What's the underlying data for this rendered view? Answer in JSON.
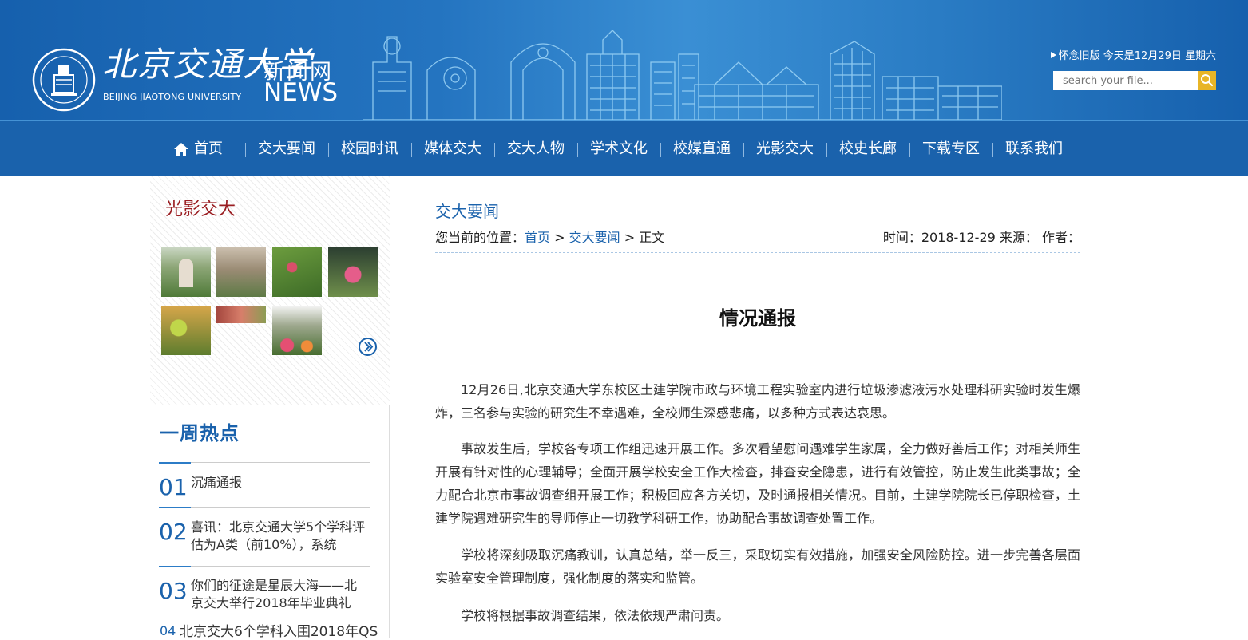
{
  "header": {
    "logo_cn": "北京交通大学",
    "logo_en": "BEIJING JIAOTONG UNIVERSITY",
    "news_cn": "新闻网",
    "news_en": "NEWS",
    "old_version": "怀念旧版",
    "date_text": "今天是12月29日  星期六",
    "search_placeholder": "search your file..."
  },
  "nav": [
    {
      "label": "首页",
      "icon": "home-icon"
    },
    {
      "label": "交大要闻"
    },
    {
      "label": "校园时讯"
    },
    {
      "label": "媒体交大"
    },
    {
      "label": "交大人物"
    },
    {
      "label": "学术文化"
    },
    {
      "label": "校媒直通"
    },
    {
      "label": "光影交大"
    },
    {
      "label": "校史长廊"
    },
    {
      "label": "下载专区"
    },
    {
      "label": "联系我们"
    }
  ],
  "sidebar": {
    "gallery_title": "光影交大",
    "hot_title": "一周热点",
    "hot": [
      {
        "num": "01",
        "text": "沉痛通报"
      },
      {
        "num": "02",
        "text": "喜讯：北京交通大学5个学科评估为A类（前10%），系统"
      },
      {
        "num": "03",
        "text": "你们的征途是星辰大海——北京交大举行2018年毕业典礼"
      },
      {
        "num": "04",
        "text": "北京交大6个学科入围2018年QS"
      }
    ]
  },
  "main": {
    "section_title": "交大要闻",
    "crumb_prefix": "您当前的位置：",
    "crumb_home": "首页",
    "crumb_sep1": " > ",
    "crumb_section": "交大要闻",
    "crumb_current": " > 正文",
    "meta": "时间：2018-12-29 来源： 作者：",
    "article_title": "情况通报",
    "paragraphs": [
      "12月26日,北京交通大学东校区土建学院市政与环境工程实验室内进行垃圾渗滤液污水处理科研实验时发生爆炸，三名参与实验的研究生不幸遇难，全校师生深感悲痛，以多种方式表达哀思。",
      "事故发生后，学校各专项工作组迅速开展工作。多次看望慰问遇难学生家属，全力做好善后工作；对相关师生开展有针对性的心理辅导；全面开展学校安全工作大检查，排查安全隐患，进行有效管控，防止发生此类事故；全力配合北京市事故调查组开展工作；积极回应各方关切，及时通报相关情况。目前，土建学院院长已停职检查，土建学院遇难研究生的导师停止一切教学科研工作，协助配合事故调查处置工作。",
      "学校将深刻吸取沉痛教训，认真总结，举一反三，采取切实有效措施，加强安全风险防控。进一步完善各层面实验室安全管理制度，强化制度的落实和监管。",
      "学校将根据事故调查结果，依法依规严肃问责。"
    ]
  },
  "colors": {
    "brand_blue": "#1a62ac",
    "gallery_title_red": "#9a1d21",
    "search_button": "#e8b527"
  }
}
